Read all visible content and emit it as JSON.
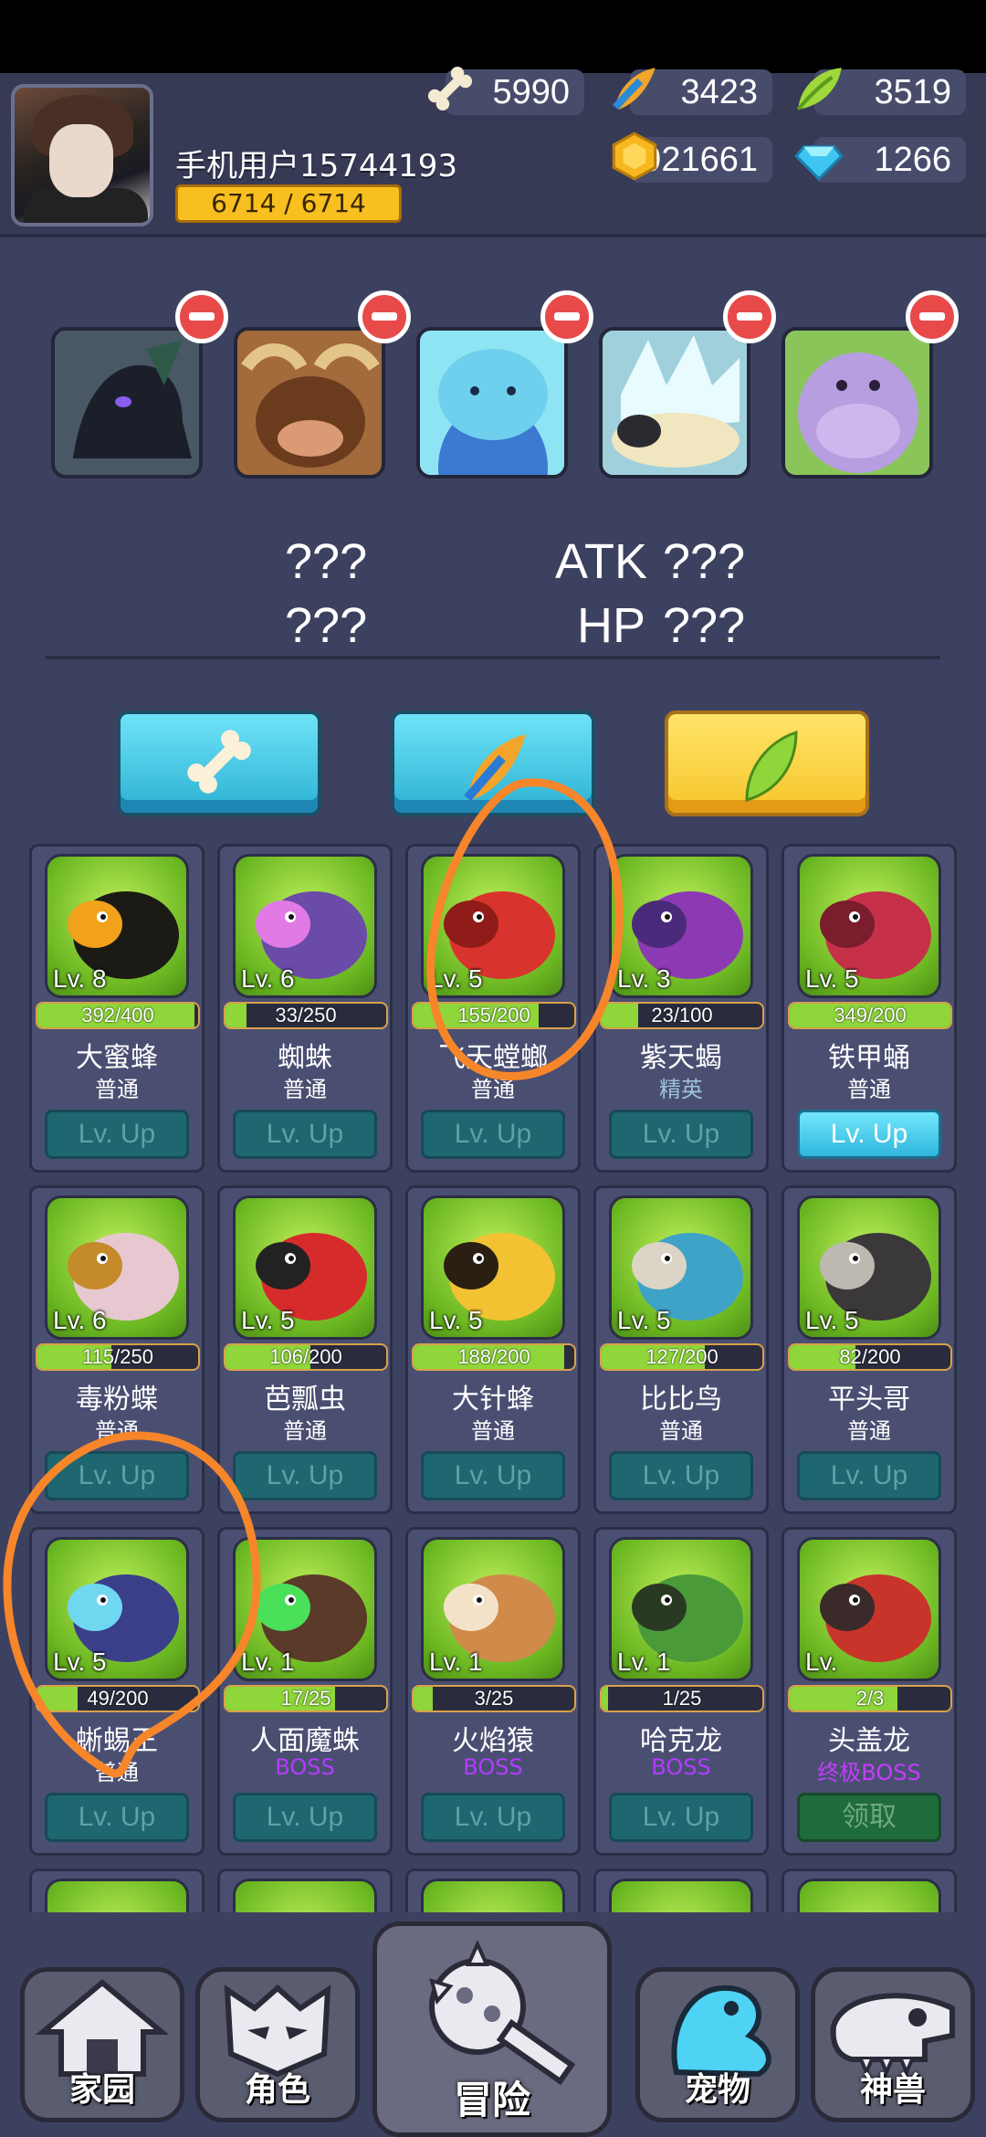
{
  "player": {
    "name": "手机用户15744193",
    "hp": "6714 / 6714"
  },
  "resources": {
    "bone": "5990",
    "feather_orange": "3423",
    "leaf_green": "3519",
    "gold": "921661",
    "diamond": "1266"
  },
  "team_slots": [
    {
      "name": "black-dragon",
      "colors": [
        "#3a4a5a",
        "#1a1f2a"
      ]
    },
    {
      "name": "bull",
      "colors": [
        "#c98a4a",
        "#6b3b1e"
      ]
    },
    {
      "name": "blue-blob",
      "colors": [
        "#7fe0f3",
        "#3b8cc9"
      ]
    },
    {
      "name": "crystal-armadillo",
      "colors": [
        "#c6ecf2",
        "#4f6e7a"
      ]
    },
    {
      "name": "purple-hippo",
      "colors": [
        "#bba1e0",
        "#7c5ea8"
      ]
    }
  ],
  "stats": {
    "left_top": "???",
    "left_bottom": "???",
    "atk_label": "ATK",
    "atk_value": "???",
    "hp_label": "HP",
    "hp_value": "???"
  },
  "pets": [
    {
      "name": "大蜜蜂",
      "rank": "普通",
      "rank_type": "normal",
      "level": "Lv. 8",
      "xp": "392/400",
      "progress": 0.98,
      "button": "Lv. Up",
      "button_state": "disabled",
      "body": "#1c1a14",
      "accent": "#f1a21a"
    },
    {
      "name": "蜘蛛",
      "rank": "普通",
      "rank_type": "normal",
      "level": "Lv. 6",
      "xp": "33/250",
      "progress": 0.13,
      "button": "Lv. Up",
      "button_state": "disabled",
      "body": "#6a4ca8",
      "accent": "#e27ae6"
    },
    {
      "name": "飞天螳螂",
      "rank": "普通",
      "rank_type": "normal",
      "level": "Lv. 5",
      "xp": "155/200",
      "progress": 0.78,
      "button": "Lv. Up",
      "button_state": "disabled",
      "body": "#d8332c",
      "accent": "#8f1c18"
    },
    {
      "name": "紫天蝎",
      "rank": "精英",
      "rank_type": "elite",
      "level": "Lv. 3",
      "xp": "23/100",
      "progress": 0.23,
      "button": "Lv. Up",
      "button_state": "disabled",
      "body": "#8b3ab3",
      "accent": "#4a2a7a"
    },
    {
      "name": "铁甲蛹",
      "rank": "普通",
      "rank_type": "normal",
      "level": "Lv. 5",
      "xp": "349/200",
      "progress": 1.0,
      "button": "Lv. Up",
      "button_state": "active",
      "body": "#c63049",
      "accent": "#7a1d2c"
    },
    {
      "name": "毒粉蝶",
      "rank": "普通",
      "rank_type": "normal",
      "level": "Lv. 6",
      "xp": "115/250",
      "progress": 0.46,
      "button": "Lv. Up",
      "button_state": "disabled",
      "body": "#e8c8d0",
      "accent": "#c58a2a"
    },
    {
      "name": "芭瓢虫",
      "rank": "普通",
      "rank_type": "normal",
      "level": "Lv. 5",
      "xp": "106/200",
      "progress": 0.53,
      "button": "Lv. Up",
      "button_state": "disabled",
      "body": "#d62b2b",
      "accent": "#222222"
    },
    {
      "name": "大针蜂",
      "rank": "普通",
      "rank_type": "normal",
      "level": "Lv. 5",
      "xp": "188/200",
      "progress": 0.94,
      "button": "Lv. Up",
      "button_state": "disabled",
      "body": "#f2c232",
      "accent": "#2a1f12"
    },
    {
      "name": "比比鸟",
      "rank": "普通",
      "rank_type": "normal",
      "level": "Lv. 5",
      "xp": "127/200",
      "progress": 0.64,
      "button": "Lv. Up",
      "button_state": "disabled",
      "body": "#3fa3c8",
      "accent": "#dcd4c4"
    },
    {
      "name": "平头哥",
      "rank": "普通",
      "rank_type": "normal",
      "level": "Lv. 5",
      "xp": "82/200",
      "progress": 0.41,
      "button": "Lv. Up",
      "button_state": "disabled",
      "body": "#3a3838",
      "accent": "#bdb8b0"
    },
    {
      "name": "蜥蜴王",
      "rank": "普通",
      "rank_type": "normal",
      "level": "Lv. 5",
      "xp": "49/200",
      "progress": 0.25,
      "button": "Lv. Up",
      "button_state": "disabled",
      "body": "#3a3f8a",
      "accent": "#6fd8f0"
    },
    {
      "name": "人面魔蛛",
      "rank": "BOSS",
      "rank_type": "boss",
      "level": "Lv. 1",
      "xp": "17/25",
      "progress": 0.68,
      "button": "Lv. Up",
      "button_state": "disabled",
      "body": "#5a3a28",
      "accent": "#4ae05a"
    },
    {
      "name": "火焰猿",
      "rank": "BOSS",
      "rank_type": "boss",
      "level": "Lv. 1",
      "xp": "3/25",
      "progress": 0.12,
      "button": "Lv. Up",
      "button_state": "disabled",
      "body": "#d08a4a",
      "accent": "#f3e2c8"
    },
    {
      "name": "哈克龙",
      "rank": "BOSS",
      "rank_type": "boss",
      "level": "Lv. 1",
      "xp": "1/25",
      "progress": 0.04,
      "button": "Lv. Up",
      "button_state": "disabled",
      "body": "#4a9a3a",
      "accent": "#2a3a22"
    },
    {
      "name": "头盖龙",
      "rank": "终极BOSS",
      "rank_type": "ultimate",
      "level": "Lv.",
      "xp": "2/3",
      "progress": 0.67,
      "button": "领取",
      "button_state": "claim",
      "body": "#c8342a",
      "accent": "#3a2a2a"
    }
  ],
  "nav": {
    "home": "家园",
    "role": "角色",
    "adventure": "冒险",
    "pet": "宠物",
    "beast": "神兽"
  }
}
